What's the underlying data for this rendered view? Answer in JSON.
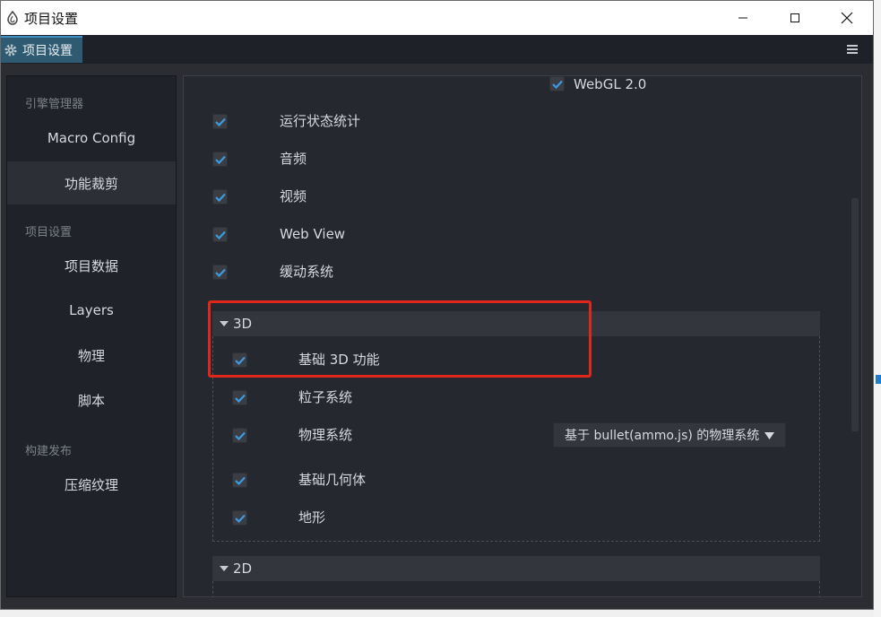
{
  "window": {
    "title": "项目设置",
    "app_icon": "circle-drop-icon",
    "controls": [
      "minimize-icon",
      "maximize-icon",
      "close-icon"
    ]
  },
  "tab": {
    "label": "项目设置",
    "icon": "gear-icon"
  },
  "menu_icon": "hamburger-icon",
  "sidebar": {
    "sections": [
      {
        "title": "引擎管理器",
        "items": [
          "Macro Config",
          "功能裁剪"
        ]
      },
      {
        "title": "项目设置",
        "items": [
          "项目数据",
          "Layers",
          "物理",
          "脚本"
        ]
      },
      {
        "title": "构建发布",
        "items": [
          "压缩纹理"
        ]
      }
    ],
    "active_item": "功能裁剪"
  },
  "content": {
    "top_items": [
      {
        "label": "WebGL 2.0",
        "checked": true
      },
      {
        "label": "运行状态统计",
        "checked": true
      },
      {
        "label": "音频",
        "checked": true
      },
      {
        "label": "视频",
        "checked": true
      },
      {
        "label": "Web View",
        "checked": true
      },
      {
        "label": "缓动系统",
        "checked": true
      }
    ],
    "groups": [
      {
        "title": "3D",
        "expanded": true,
        "items": [
          {
            "label": "基础 3D 功能",
            "checked": true
          },
          {
            "label": "粒子系统",
            "checked": true
          },
          {
            "label": "物理系统",
            "checked": true,
            "select": "基于 bullet(ammo.js) 的物理系统"
          },
          {
            "label": "基础几何体",
            "checked": true
          },
          {
            "label": "地形",
            "checked": true
          }
        ]
      },
      {
        "title": "2D",
        "expanded": true,
        "items": []
      }
    ]
  },
  "colors": {
    "window_bg": "#2b2d33",
    "tab_active": "#2f5b72",
    "checkmark": "#3c9be0",
    "highlight": "#e1261c"
  }
}
